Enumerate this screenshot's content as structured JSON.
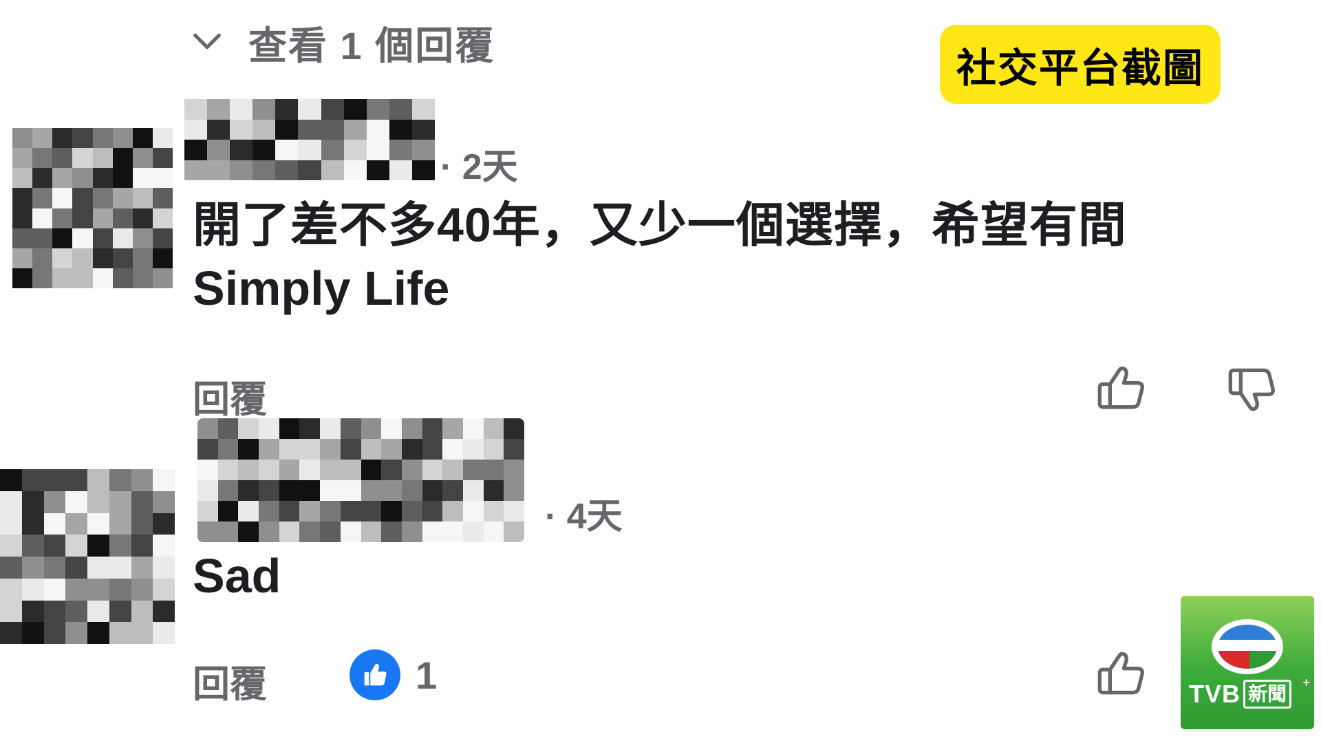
{
  "view_replies": {
    "label": "查看 1 個回覆",
    "icon": "chevron-down-icon"
  },
  "badge": {
    "label": "社交平台截圖",
    "color": "#ffe617"
  },
  "comments": [
    {
      "time": "· 2天",
      "text_line1": "開了差不多40年，又少一個選擇，希望有間",
      "text_line2": "Simply Life",
      "reply_label": "回覆",
      "like_icon": "thumbs-up-icon",
      "dislike_icon": "thumbs-down-icon"
    },
    {
      "time": "· 4天",
      "text_line1": "Sad",
      "reply_label": "回覆",
      "reaction_count": "1",
      "reaction_icon": "like-reaction-icon",
      "like_icon": "thumbs-up-icon"
    }
  ],
  "watermark": {
    "logo_text": "TVB",
    "news_text": "新聞",
    "plus": "+"
  },
  "colors": {
    "secondary_text": "#65676b",
    "primary_text": "#1c1e21",
    "reaction_blue": "#1877f2",
    "tvb_green": "#3cab3a"
  }
}
